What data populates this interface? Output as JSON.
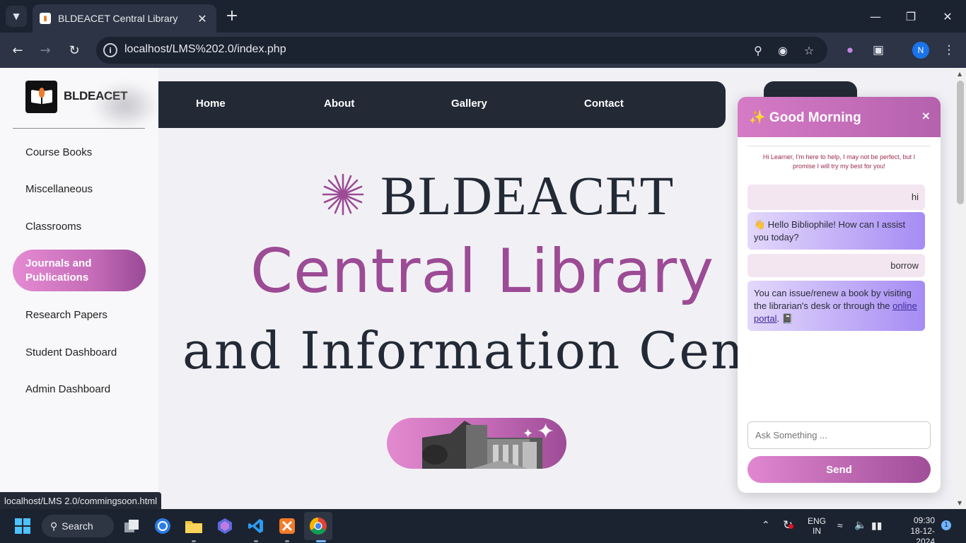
{
  "browser": {
    "tab_title": "BLDEACET Central Library",
    "url": "localhost/LMS%202.0/index.php",
    "profile_initial": "N"
  },
  "sidebar": {
    "brand": "BLDEACET",
    "items": [
      {
        "label": "Course Books"
      },
      {
        "label": "Miscellaneous"
      },
      {
        "label": "Classrooms"
      },
      {
        "label": "Journals and Publications"
      },
      {
        "label": "Research Papers"
      },
      {
        "label": "Student Dashboard"
      },
      {
        "label": "Admin Dashboard"
      }
    ],
    "active_index": 3
  },
  "nav": {
    "links": [
      {
        "label": "Home"
      },
      {
        "label": "About"
      },
      {
        "label": "Gallery"
      },
      {
        "label": "Contact"
      }
    ]
  },
  "hero": {
    "line1": "BLDEACET",
    "line2": "Central Library",
    "line3": "and Information Center"
  },
  "chat": {
    "title": "✨ Good Morning",
    "close": "×",
    "intro": "Hi Learner, I'm here to help, I may not be perfect, but I promise I will try my best for you!",
    "messages": [
      {
        "role": "user",
        "text": "hi"
      },
      {
        "role": "bot",
        "text": "👋 Hello Bibliophile! How can I assist you today?"
      },
      {
        "role": "user",
        "text": "borrow"
      },
      {
        "role": "bot",
        "text_before": "You can issue/renew a book by visiting the librarian's desk or through the ",
        "link": "online portal",
        "text_after": ". 📓"
      }
    ],
    "input_placeholder": "Ask Something ...",
    "send_label": "Send"
  },
  "status_url": "localhost/LMS 2.0/commingsoon.html",
  "taskbar": {
    "search_label": "Search",
    "lang_line1": "ENG",
    "lang_line2": "IN",
    "time": "09:30",
    "date": "18-12-2024",
    "notification_count": "1"
  },
  "colors": {
    "accent_purple": "#9c4b95",
    "nav_dark": "#232a36",
    "pink_gradient_start": "#e38ad0"
  }
}
